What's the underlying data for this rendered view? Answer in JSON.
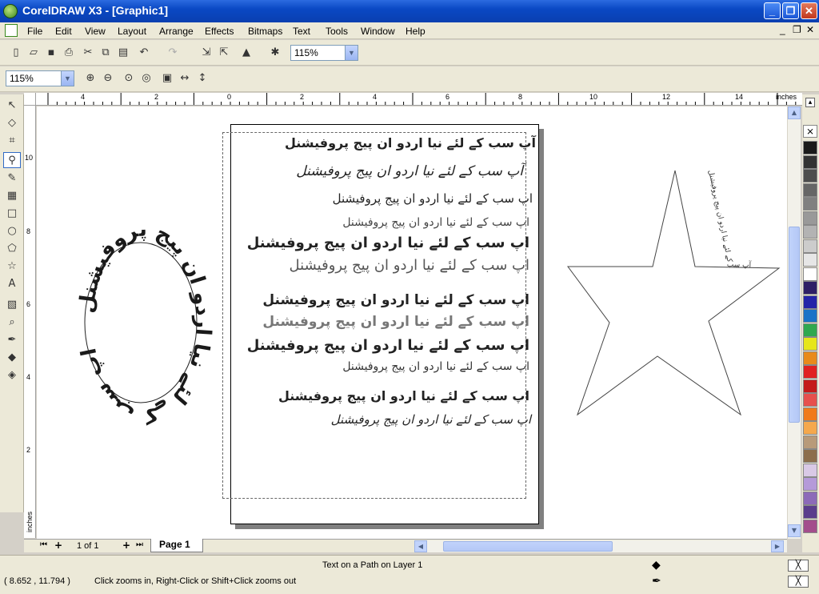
{
  "title": "CorelDRAW X3 - [Graphic1]",
  "window_controls": {
    "minimize": "_",
    "restore": "❐",
    "close": "✕"
  },
  "menu": [
    "File",
    "Edit",
    "View",
    "Layout",
    "Arrange",
    "Effects",
    "Bitmaps",
    "Text",
    "Tools",
    "Window",
    "Help"
  ],
  "standard_toolbar": {
    "zoom_value": "115%"
  },
  "zoom_toolbar": {
    "zoom_value": "115%"
  },
  "ruler": {
    "unit": "inches",
    "top_labels": [
      "4",
      "2",
      "0",
      "2",
      "4",
      "6",
      "8",
      "10",
      "12",
      "14"
    ],
    "left_labels": [
      "10",
      "8",
      "6",
      "4",
      "2"
    ],
    "left_unit": "inches"
  },
  "page_nav": {
    "counter": "1 of 1",
    "tab": "Page 1"
  },
  "status": {
    "coords": "( 8.652 , 11.794 )",
    "hint": "Click zooms in, Right-Click or Shift+Click zooms out",
    "object": "Text on a Path on Layer 1"
  },
  "document": {
    "urdu_lines": [
      "آپ سب کے لئے نیا اردو ان پیج پروفیشنل",
      "آپ سب کے لئے نیا اردو ان پیج پروفیشنل",
      "اپ سب کے لئے نیا اردو ان پیج پروفیشنل",
      "اپ سب کے لئے نیا اردو ان پیج پروفیشنل",
      "اپ سب کے لئے نیا اردو ان پیج پروفیشنل",
      "اپ سب کے لئے نیا اردو ان پیج پروفیشنل",
      "اپ سب کے لئے نیا اردو ان پیج پروفیشنل",
      "اپ سب کے لئے نیا اردو ان پیج پروفیشنل",
      "اپ سب کے لئے نیا اردو ان پیج پروفیشنل",
      "اپ سب کے لئے نیا اردو ان پیج پروفیشنل",
      "اپ سب کے لئے نیا اردو ان پیج پروفیشنل",
      "اپ سب کے لئے نیا اردو ان پیج پروفیشنل"
    ],
    "ellipse_text": "اپ سب کے لئے نیا اردو ان پیج پروفیشنل",
    "star_text": "آپ سب کے لئے نیا اردو ان پیج پروفیشنل"
  },
  "palette_colors": [
    "#1a1a1a",
    "#333333",
    "#4d4d4d",
    "#666666",
    "#808080",
    "#999999",
    "#b3b3b3",
    "#cccccc",
    "#e6e6e6",
    "#ffffff",
    "#2e1f66",
    "#2424a8",
    "#1a73c7",
    "#2fa84f",
    "#e6e61a",
    "#e88a1a",
    "#e02020",
    "#c41a1a",
    "#e6504d",
    "#f07a1a",
    "#f5a84d",
    "#b89a7a",
    "#8c6e4d",
    "#d9c9e6",
    "#b59ad9",
    "#8c6ab8",
    "#5a3d8c",
    "#a34d8c"
  ],
  "accent": "#0a48c4"
}
